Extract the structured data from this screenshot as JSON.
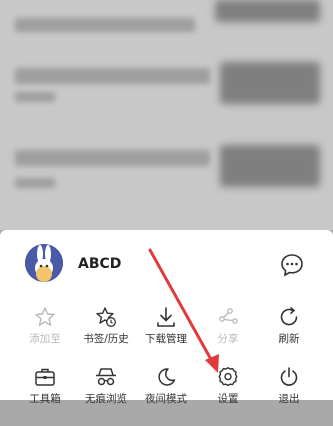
{
  "profile": {
    "name": "ABCD",
    "avatar_icon": "rabbit-avatar",
    "message_icon": "chat-bubble-icon"
  },
  "menu": {
    "row1": [
      {
        "label": "添加至",
        "icon": "star-icon",
        "enabled": false
      },
      {
        "label": "书签/历史",
        "icon": "bookmark-history-icon",
        "enabled": true
      },
      {
        "label": "下载管理",
        "icon": "download-icon",
        "enabled": true
      },
      {
        "label": "分享",
        "icon": "share-icon",
        "enabled": false
      },
      {
        "label": "刷新",
        "icon": "refresh-icon",
        "enabled": true
      }
    ],
    "row2": [
      {
        "label": "工具箱",
        "icon": "toolbox-icon"
      },
      {
        "label": "无痕浏览",
        "icon": "incognito-icon"
      },
      {
        "label": "夜间模式",
        "icon": "moon-icon"
      },
      {
        "label": "设置",
        "icon": "gear-icon"
      },
      {
        "label": "退出",
        "icon": "power-icon"
      }
    ]
  },
  "colors": {
    "annotation_arrow": "#e03a3a",
    "avatar_bg": "#4b5aa7"
  }
}
